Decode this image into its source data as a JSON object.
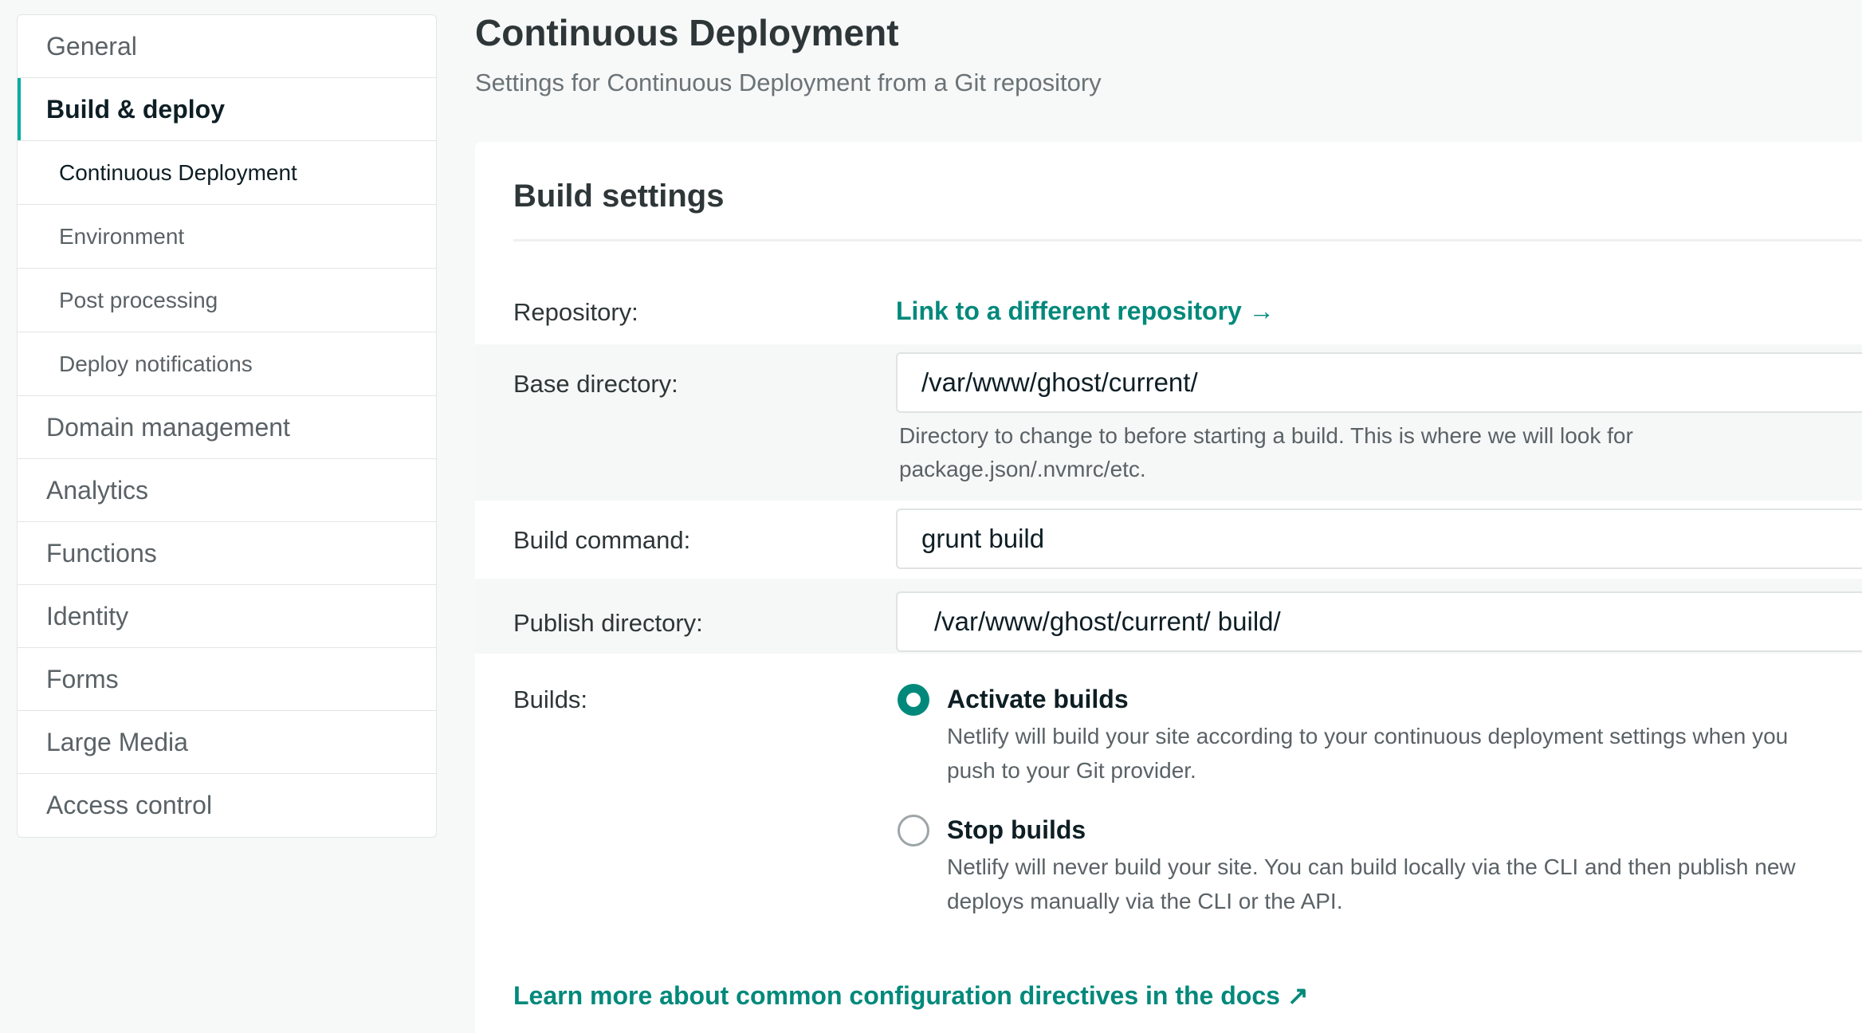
{
  "sidebar": {
    "items": [
      {
        "label": "General"
      },
      {
        "label": "Build & deploy"
      },
      {
        "label": "Domain management"
      },
      {
        "label": "Analytics"
      },
      {
        "label": "Functions"
      },
      {
        "label": "Identity"
      },
      {
        "label": "Forms"
      },
      {
        "label": "Large Media"
      },
      {
        "label": "Access control"
      }
    ],
    "subitems": [
      {
        "label": "Continuous Deployment"
      },
      {
        "label": "Environment"
      },
      {
        "label": "Post processing"
      },
      {
        "label": "Deploy notifications"
      }
    ]
  },
  "header": {
    "title": "Continuous Deployment",
    "subtitle": "Settings for Continuous Deployment from a Git repository"
  },
  "build_settings": {
    "title": "Build settings",
    "repository": {
      "label": "Repository:",
      "link_text": "Link to a different repository →"
    },
    "base_directory": {
      "label": "Base directory:",
      "value": "/var/www/ghost/current/",
      "help_line1": "Directory to change to before starting a build. This is where we will look for",
      "help_line2": "package.json/.nvmrc/etc."
    },
    "build_command": {
      "label": "Build command:",
      "value": "grunt build"
    },
    "publish_directory": {
      "label": "Publish directory:",
      "value": "/var/www/ghost/current/  build/"
    },
    "builds": {
      "label": "Builds:",
      "options": [
        {
          "title": "Activate builds",
          "desc_line1": "Netlify will build your site according to your continuous deployment settings when you",
          "desc_line2": "push to your Git provider.",
          "selected": true
        },
        {
          "title": "Stop builds",
          "desc_line1": "Netlify will never build your site. You can build locally via the CLI and then publish new",
          "desc_line2": "deploys manually via the CLI or the API.",
          "selected": false
        }
      ]
    },
    "docs_link": "Learn more about common configuration directives in the docs ↗"
  },
  "colors": {
    "accent": "#00897b",
    "active_bar": "#00ad9f",
    "background": "#f7f8f8"
  }
}
